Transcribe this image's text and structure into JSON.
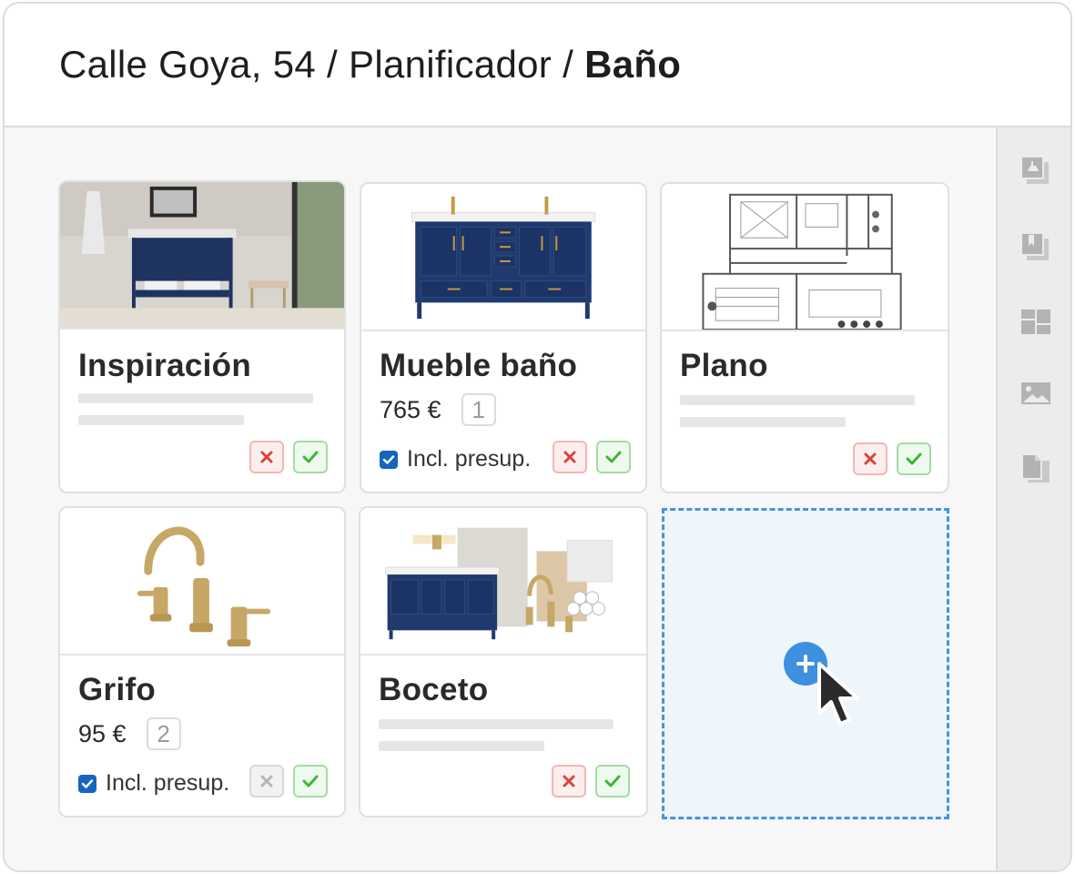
{
  "breadcrumb": {
    "address": "Calle Goya, 54",
    "section": "Planificador",
    "current": "Baño",
    "separator": "/"
  },
  "sidebar": {
    "icons": [
      "lamp-icon",
      "bookmark-icon",
      "layout-icon",
      "image-icon",
      "document-icon"
    ]
  },
  "cards": [
    {
      "title": "Inspiración",
      "image": "bathroom-inspiration-photo"
    },
    {
      "title": "Mueble baño",
      "image": "blue-vanity-cabinet",
      "price": "765 €",
      "quantity": "1",
      "budget_label": "Incl. presup.",
      "included": true
    },
    {
      "title": "Plano",
      "image": "floor-plan"
    },
    {
      "title": "Grifo",
      "image": "gold-faucet",
      "price": "95 €",
      "quantity": "2",
      "budget_label": "Incl. presup.",
      "included": true
    },
    {
      "title": "Boceto",
      "image": "moodboard-sketch"
    }
  ],
  "dropzone": {
    "action": "add"
  },
  "colors": {
    "accent": "#3d8fe0",
    "dropzone_border": "#4a94d6",
    "reject": "#d9433b",
    "accept": "#3fb536",
    "checkbox": "#1565c0"
  }
}
